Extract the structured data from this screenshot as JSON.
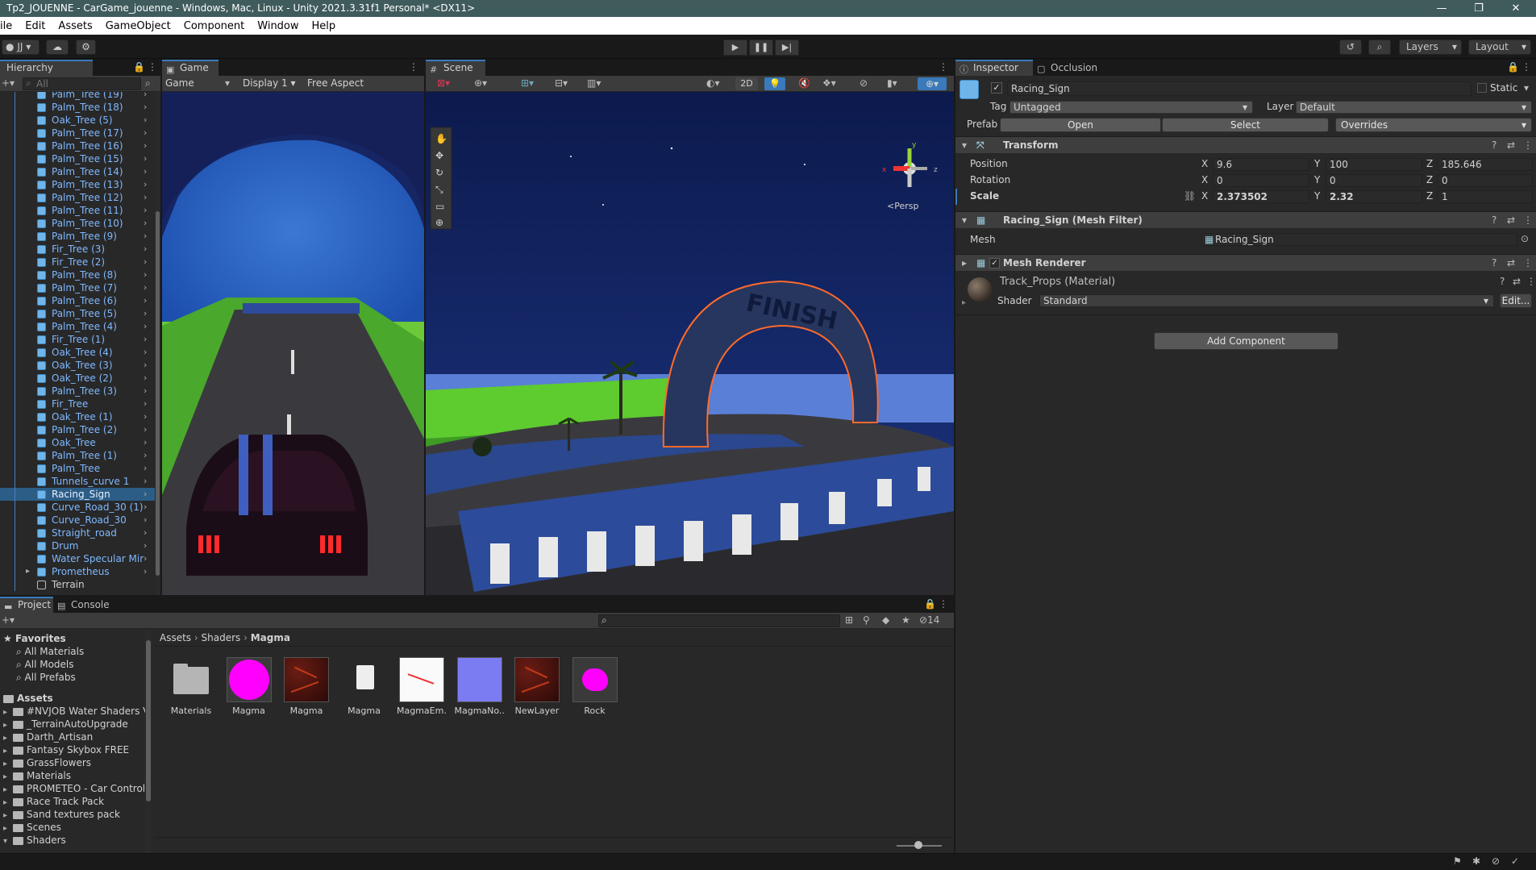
{
  "window": {
    "title": "Tp2_JOUENNE - CarGame_jouenne - Windows, Mac, Linux - Unity 2021.3.31f1 Personal* <DX11>",
    "controls": [
      "—",
      "❐",
      "✕"
    ]
  },
  "menu": [
    "ile",
    "Edit",
    "Assets",
    "GameObject",
    "Component",
    "Window",
    "Help"
  ],
  "toolbar": {
    "account": "JJ",
    "layers": "Layers",
    "layout": "Layout"
  },
  "hierarchy": {
    "tab": "Hierarchy",
    "search_placeholder": "All",
    "items": [
      "Palm_Tree (19)",
      "Palm_Tree (18)",
      "Oak_Tree (5)",
      "Palm_Tree (17)",
      "Palm_Tree (16)",
      "Palm_Tree (15)",
      "Palm_Tree (14)",
      "Palm_Tree (13)",
      "Palm_Tree (12)",
      "Palm_Tree (11)",
      "Palm_Tree (10)",
      "Palm_Tree (9)",
      "Fir_Tree (3)",
      "Fir_Tree (2)",
      "Palm_Tree (8)",
      "Palm_Tree (7)",
      "Palm_Tree (6)",
      "Palm_Tree (5)",
      "Palm_Tree (4)",
      "Fir_Tree (1)",
      "Oak_Tree (4)",
      "Oak_Tree (3)",
      "Oak_Tree (2)",
      "Palm_Tree (3)",
      "Fir_Tree",
      "Oak_Tree (1)",
      "Palm_Tree (2)",
      "Oak_Tree",
      "Palm_Tree (1)",
      "Palm_Tree",
      "Tunnels_curve 1",
      "Racing_Sign",
      "Curve_Road_30 (1)",
      "Curve_Road_30",
      "Straight_road",
      "Drum",
      "Water Specular Mir",
      "Prometheus",
      "Terrain"
    ],
    "selected": "Racing_Sign"
  },
  "game": {
    "tab": "Game",
    "mode": "Game",
    "display": "Display 1",
    "aspect": "Free Aspect"
  },
  "scene": {
    "tab": "Scene",
    "mode_2d": "2D",
    "gizmo_label": "<Persp",
    "finish_text": "FINISH"
  },
  "inspector": {
    "tab": "Inspector",
    "tab2": "Occlusion",
    "object_name": "Racing_Sign",
    "static_label": "Static",
    "tag_label": "Tag",
    "tag_value": "Untagged",
    "layer_label": "Layer",
    "layer_value": "Default",
    "prefab_label": "Prefab",
    "open_btn": "Open",
    "select_btn": "Select",
    "overrides_btn": "Overrides",
    "transform": {
      "title": "Transform",
      "position_label": "Position",
      "rotation_label": "Rotation",
      "scale_label": "Scale",
      "position": {
        "x": "9.6",
        "y": "100",
        "z": "185.646"
      },
      "rotation": {
        "x": "0",
        "y": "0",
        "z": "0"
      },
      "scale": {
        "x": "2.373502",
        "y": "2.32",
        "z": "1"
      }
    },
    "mesh_filter": {
      "title": "Racing_Sign (Mesh Filter)",
      "mesh_label": "Mesh",
      "mesh_value": "Racing_Sign"
    },
    "mesh_renderer": {
      "title": "Mesh Renderer"
    },
    "material": {
      "title": "Track_Props (Material)",
      "shader_label": "Shader",
      "shader_value": "Standard",
      "edit_btn": "Edit..."
    },
    "add_component": "Add Component"
  },
  "project": {
    "tab": "Project",
    "tab2": "Console",
    "hidden_count": "14",
    "favorites_label": "Favorites",
    "favorites": [
      "All Materials",
      "All Models",
      "All Prefabs"
    ],
    "assets_label": "Assets",
    "folders": [
      "#NVJOB Water Shaders V",
      "_TerrainAutoUpgrade",
      "Darth_Artisan",
      "Fantasy Skybox FREE",
      "GrassFlowers",
      "Materials",
      "PROMETEO - Car Controll",
      "Race Track Pack",
      "Sand textures pack",
      "Scenes",
      "Shaders"
    ],
    "breadcrumb": [
      "Assets",
      "Shaders",
      "Magma"
    ],
    "assets": [
      {
        "name": "Materials",
        "kind": "folder"
      },
      {
        "name": "Magma",
        "kind": "magenta-sphere"
      },
      {
        "name": "Magma",
        "kind": "lava"
      },
      {
        "name": "Magma",
        "kind": "file"
      },
      {
        "name": "MagmaEm...",
        "kind": "emission"
      },
      {
        "name": "MagmaNo...",
        "kind": "normal"
      },
      {
        "name": "NewLayer",
        "kind": "lava"
      },
      {
        "name": "Rock",
        "kind": "magenta-rock"
      }
    ]
  },
  "colors": {
    "accent": "#3a79bb",
    "selection": "#2c5d87",
    "prefab_text": "#7fb8ff"
  }
}
